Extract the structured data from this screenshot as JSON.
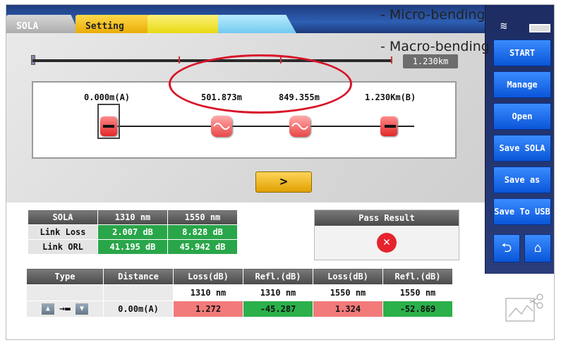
{
  "tabs": [
    {
      "label": "SOLA"
    },
    {
      "label": "Setting"
    },
    {
      "label": ""
    },
    {
      "label": ""
    }
  ],
  "annotations": {
    "micro": "- Micro-bending",
    "macro": "- Macro-bending"
  },
  "link": {
    "length": "1.230km",
    "events": [
      {
        "label": "0.000m(A)"
      },
      {
        "label": "501.873m"
      },
      {
        "label": "849.355m"
      },
      {
        "label": "1.230Km(B)"
      }
    ]
  },
  "next_label": ">",
  "sidebar": {
    "buttons": [
      "START",
      "Manage",
      "Open",
      "Save SOLA",
      "Save as",
      "Save To USB"
    ]
  },
  "summary": {
    "headers": [
      "SOLA",
      "1310 nm",
      "1550 nm"
    ],
    "rows": [
      {
        "label": "Link Loss",
        "v1310": "2.007 dB",
        "v1550": "8.828 dB"
      },
      {
        "label": "Link ORL",
        "v1310": "41.195 dB",
        "v1550": "45.942 dB"
      }
    ]
  },
  "pass": {
    "title": "Pass Result",
    "icon": "fail-icon"
  },
  "events_table": {
    "headers": [
      "Type",
      "Distance",
      "Loss(dB)",
      "Refl.(dB)",
      "Loss(dB)",
      "Refl.(dB)"
    ],
    "wavelengths": [
      "1310 nm",
      "1310 nm",
      "1550 nm",
      "1550 nm"
    ],
    "row": {
      "distance": "0.00m(A)",
      "loss1310": "1.272",
      "refl1310": "-45.287",
      "loss1550": "1.324",
      "refl1550": "-52.869"
    }
  },
  "colors": {
    "accent": "#0a55d8",
    "fail": "#e5232d",
    "pass_cell": "#2aa64a",
    "loss_cell": "#f27a7a",
    "highlight": "#d9142a"
  }
}
